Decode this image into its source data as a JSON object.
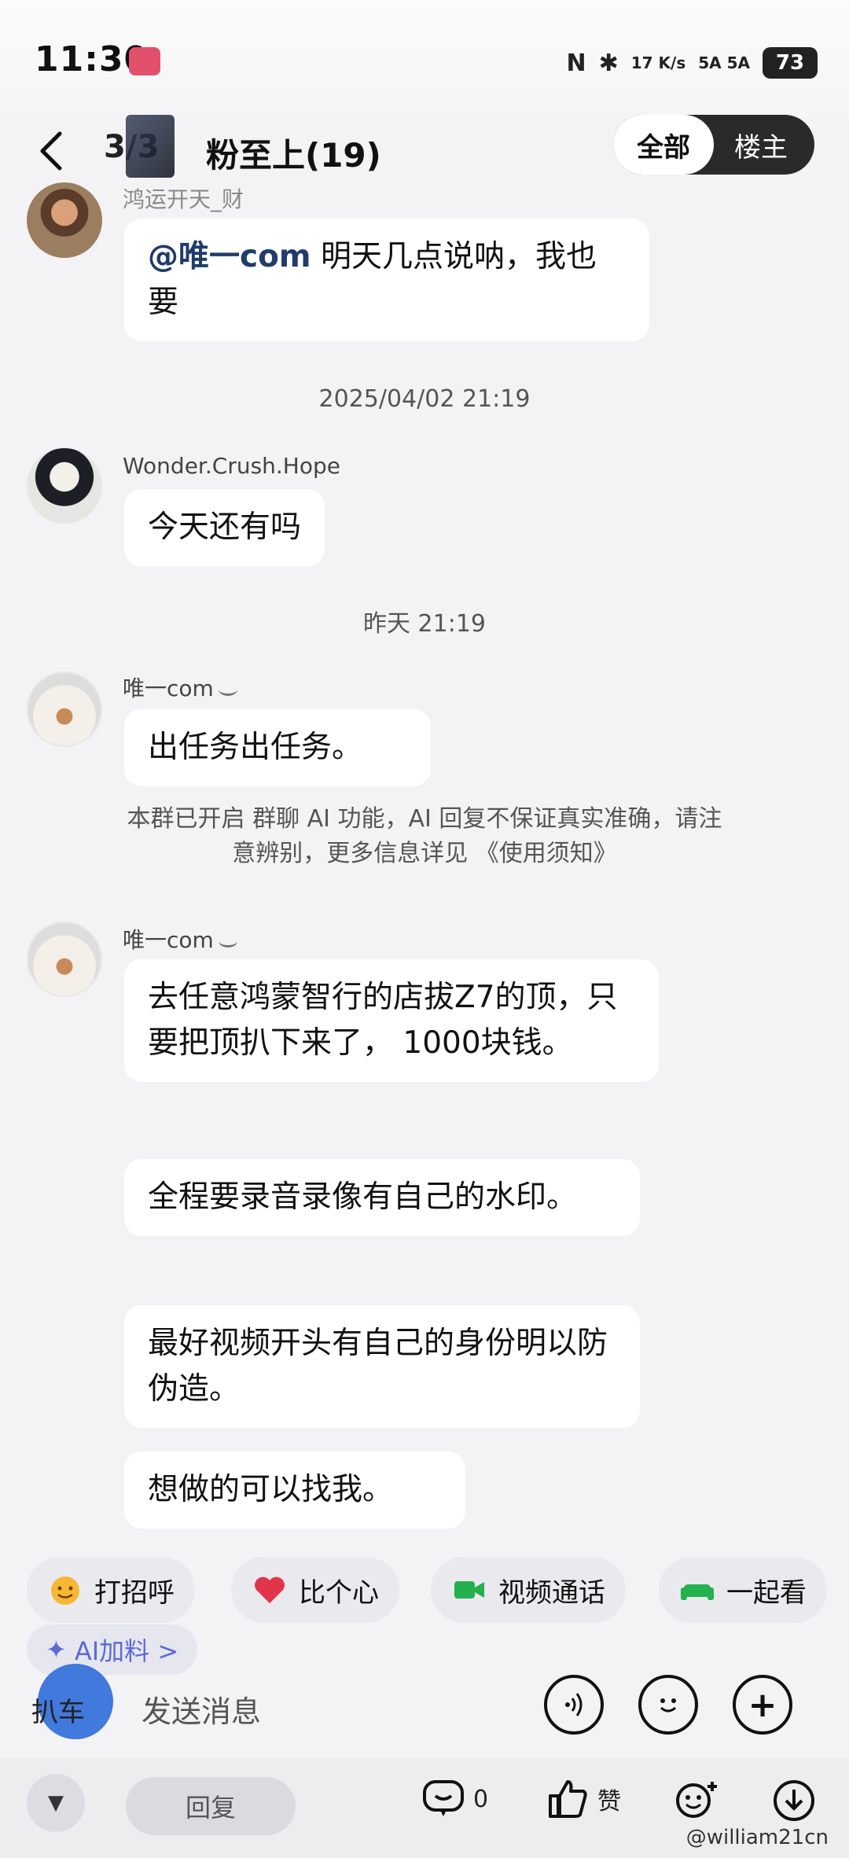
{
  "status_bar": {
    "time": "11:30",
    "net_speed": "17 K/s",
    "signal": "5A 5A",
    "battery": "73"
  },
  "header": {
    "page": "3/3",
    "title": "粉至上(19)",
    "tab_all": "全部",
    "tab_owner": "楼主"
  },
  "messages": {
    "m0": {
      "nickname": "鸿运开天_财",
      "text_mention": "@唯一com",
      "text": " 明天几点说呐，我也要"
    },
    "ts1": "2025/04/02 21:19",
    "m1": {
      "nickname": "Wonder.Crush.Hope",
      "text": "今天还有吗"
    },
    "ts2": "昨天 21:19",
    "m2": {
      "nickname": "唯一com",
      "text": "出任务出任务。"
    },
    "system_notice": "本群已开启 群聊 AI 功能，AI 回复不保证真实准确，请注意辨别，更多信息详见 《使用须知》",
    "m3": {
      "nickname": "唯一com",
      "b1": "去任意鸿蒙智行的店拔Z7的顶，只要把顶扒下来了， 1000块钱。",
      "b2": "全程要录音录像有自己的水印。",
      "b3": "最好视频开头有自己的身份明以防伪造。",
      "b4": "想做的可以找我。"
    }
  },
  "quick_actions": {
    "greet": "打招呼",
    "heart": "比个心",
    "video_call": "视频通话",
    "watch_together": "一起看",
    "ai_chip": "AI加料 >"
  },
  "input": {
    "voice_label": "扒车",
    "placeholder": "发送消息"
  },
  "bottom_bar": {
    "reply": "回复",
    "comment_count": "0",
    "like": "赞",
    "watermark": "@william21cn"
  },
  "colors": {
    "mention": "#1f3c6a",
    "heart": "#e2344a",
    "video": "#22b14c",
    "ai": "#5b6bd6"
  }
}
